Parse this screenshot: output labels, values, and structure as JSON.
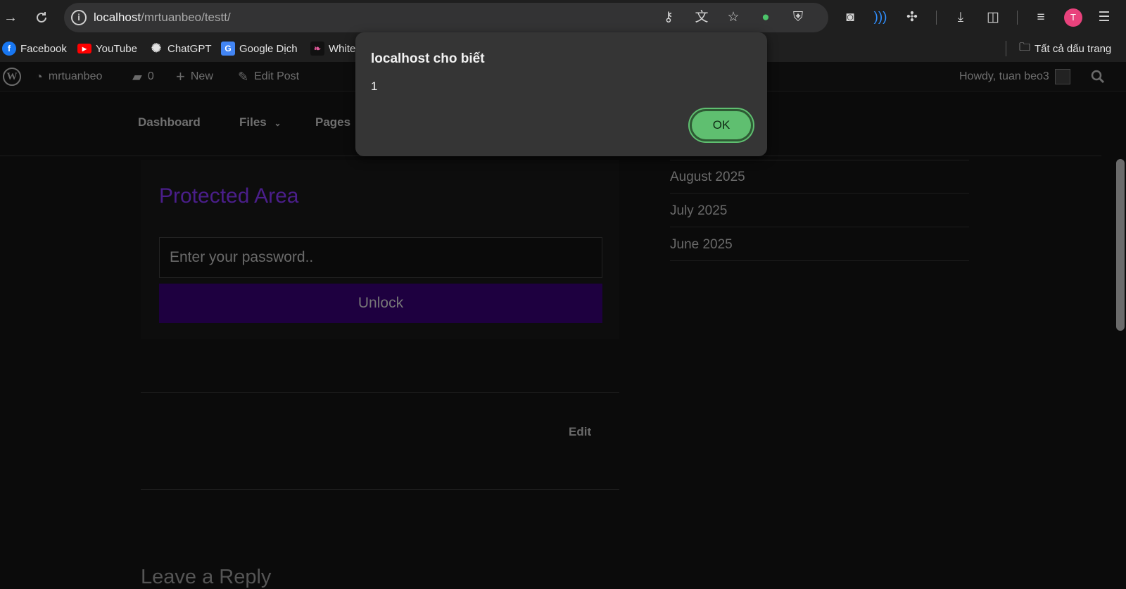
{
  "browser": {
    "url_host": "localhost",
    "url_path": "/mrtuanbeo/testt/",
    "profile_initial": "T",
    "accent_colors": {
      "profile": "#e8427c",
      "ok_button": "#5fbf70",
      "protected_title": "#4a1e8a",
      "unlock_button": "#1e0040"
    },
    "icons": [
      "back-arrow-icon",
      "reload-icon",
      "site-info-icon",
      "password-key-icon",
      "translate-icon",
      "bookmark-star-icon",
      "dark-reader-moon-icon",
      "shield-extension-icon",
      "camera-extension-icon",
      "wifi-extension-icon",
      "extensions-puzzle-icon",
      "downloads-icon",
      "side-panel-icon",
      "reading-list-icon",
      "menu-icon"
    ]
  },
  "bookmarks": {
    "items": [
      {
        "label": "Facebook",
        "icon": "f"
      },
      {
        "label": "YouTube",
        "icon": "▶"
      },
      {
        "label": "ChatGPT",
        "icon": "✺"
      },
      {
        "label": "Google Dịch",
        "icon": "G"
      },
      {
        "label": "White",
        "icon": "❧"
      }
    ],
    "all_bookmarks": "Tất cả dấu trang"
  },
  "adminbar": {
    "logo": "W",
    "site_name": "mrtuanbeo",
    "comments_count": "0",
    "new_label": "New",
    "edit_post_label": "Edit Post",
    "howdy": "Howdy, tuan beo3"
  },
  "site_nav": {
    "items": [
      "Dashboard",
      "Files",
      "Pages"
    ]
  },
  "main": {
    "protected_title": "Protected Area",
    "password_placeholder": "Enter your password..",
    "unlock_label": "Unlock",
    "edit_label": "Edit",
    "reply_heading": "Leave a Reply"
  },
  "sidebar": {
    "archives": [
      "August 2025",
      "July 2025",
      "June 2025"
    ]
  },
  "dialog": {
    "title": "localhost cho biết",
    "message": "1",
    "ok_label": "OK"
  }
}
